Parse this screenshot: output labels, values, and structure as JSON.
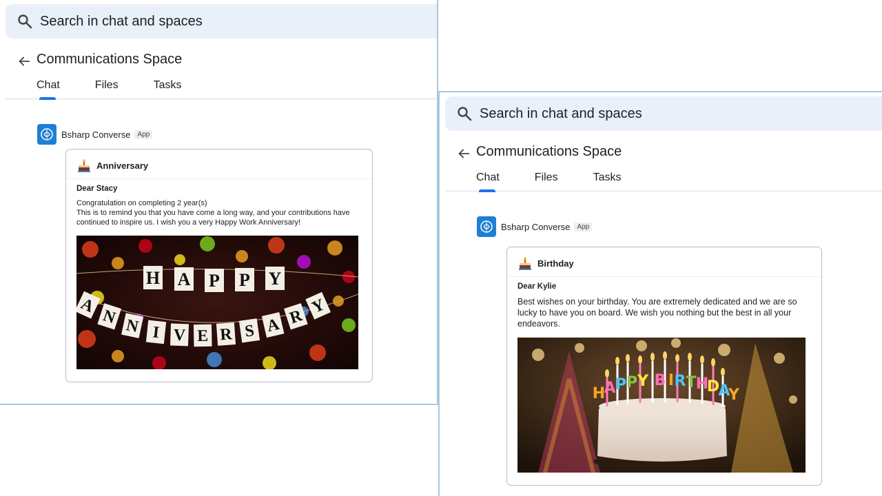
{
  "windows": [
    {
      "search_placeholder": "Search in chat and spaces",
      "space_title": "Communications Space",
      "tabs": [
        "Chat",
        "Files",
        "Tasks"
      ],
      "sender_name": "Bsharp Converse",
      "sender_badge": "App",
      "card_title": "Anniversary",
      "greeting": "Dear Stacy",
      "message_line1": "Congratulation on completing 2 year(s)",
      "message_line2": "This is to remind you that you have come a long way, and your contributions have continued to inspire us. I wish you a very Happy Work Anniversary!",
      "banner_word1": "HAPPY",
      "banner_word2": "ANNIVERSARY"
    },
    {
      "search_placeholder": "Search in chat and spaces",
      "space_title": "Communications Space",
      "tabs": [
        "Chat",
        "Files",
        "Tasks"
      ],
      "sender_name": "Bsharp Converse",
      "sender_badge": "App",
      "card_title": "Birthday",
      "greeting": "Dear Kylie",
      "message": "Best wishes on your birthday. You are extremely dedicated and we are so lucky to have you on board. We wish you nothing but the best in all your endeavors.",
      "candle_text": "HAPPY BIRTHDAY"
    }
  ],
  "colors": {
    "search_bg": "#e9f0f9",
    "accent": "#1a73e8",
    "app_icon": "#1f7fd4",
    "window_border": "#a9c8de"
  },
  "icons": [
    "search-icon",
    "back-arrow-icon",
    "app-logo-icon",
    "cake-icon"
  ]
}
